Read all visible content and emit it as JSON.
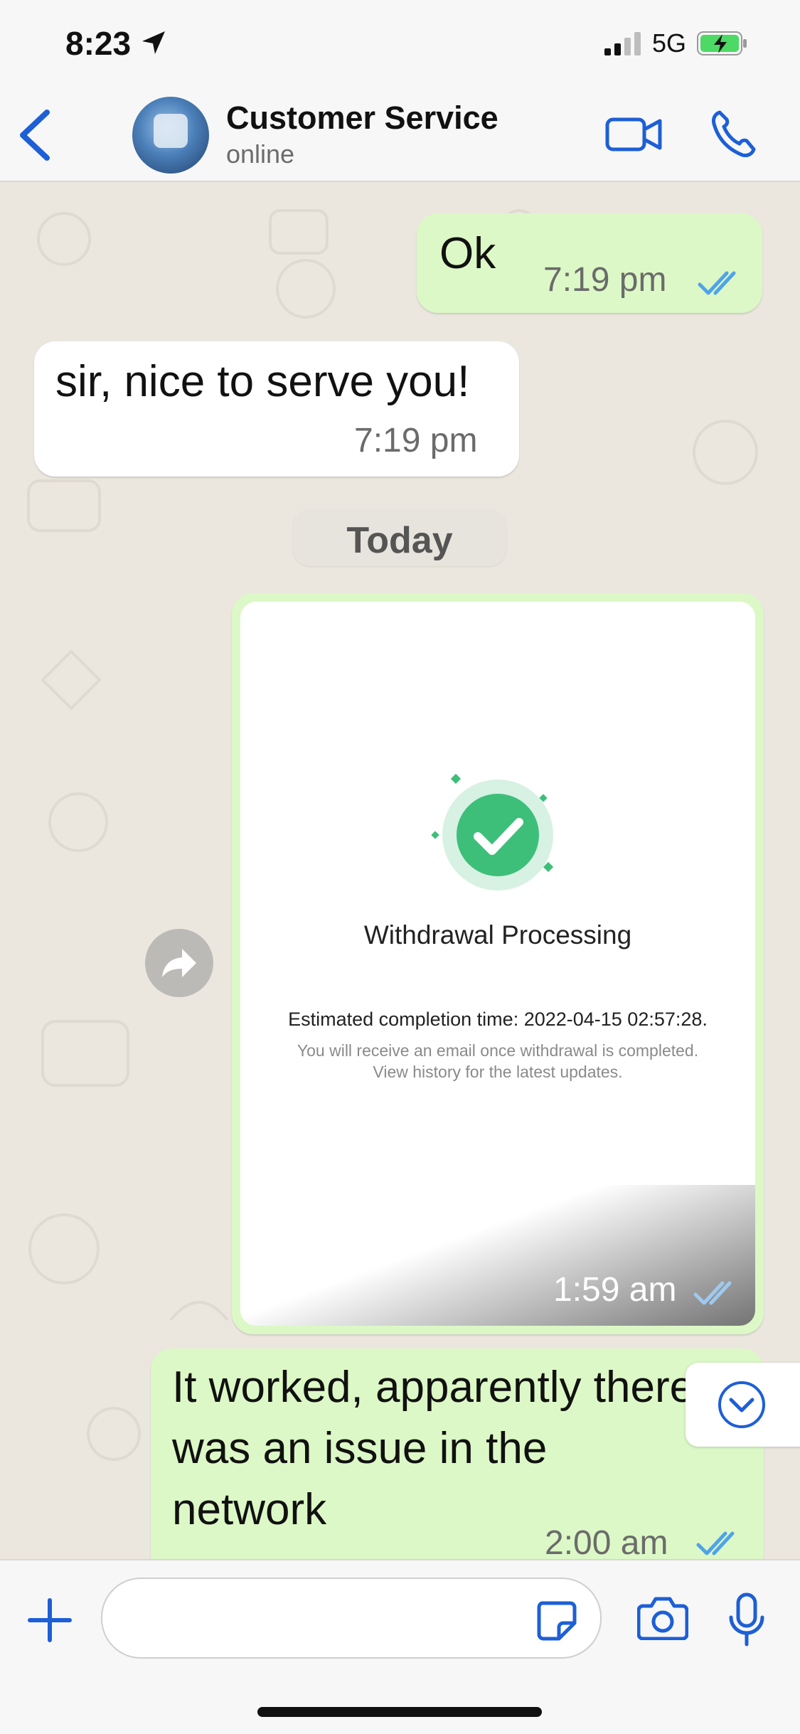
{
  "status_bar": {
    "time": "8:23",
    "network": "5G"
  },
  "header": {
    "contact_name": "Customer Service",
    "contact_status": "online"
  },
  "messages": [
    {
      "text": "Ok",
      "time": "7:19 pm"
    },
    {
      "text": "sir, nice to serve you!",
      "time": "7:19 pm"
    },
    {
      "date_separator": "Today"
    },
    {
      "image": {
        "title": "Withdrawal Processing",
        "estimated": "Estimated completion time: 2022-04-15 02:57:28.",
        "note_line1": "You will receive an email once withdrawal is completed.",
        "note_line2": "View history for the latest updates."
      },
      "time": "1:59 am"
    },
    {
      "lines": [
        "It worked, apparently there",
        "was an issue in the",
        "network"
      ],
      "time": "2:00 am"
    }
  ],
  "colors": {
    "accent": "#1d5fd6",
    "outgoing_bubble": "#dcf8c6",
    "incoming_bubble": "#ffffff",
    "read_ticks": "#4fa3e8",
    "success": "#3dbf7a"
  },
  "icons": [
    "location-arrow-icon",
    "signal-icon",
    "battery-charging-icon",
    "back-chevron-icon",
    "video-call-icon",
    "phone-icon",
    "double-check-icon",
    "check-icon",
    "forward-icon",
    "chevron-down-icon",
    "plus-icon",
    "sticker-icon",
    "camera-icon",
    "microphone-icon"
  ]
}
